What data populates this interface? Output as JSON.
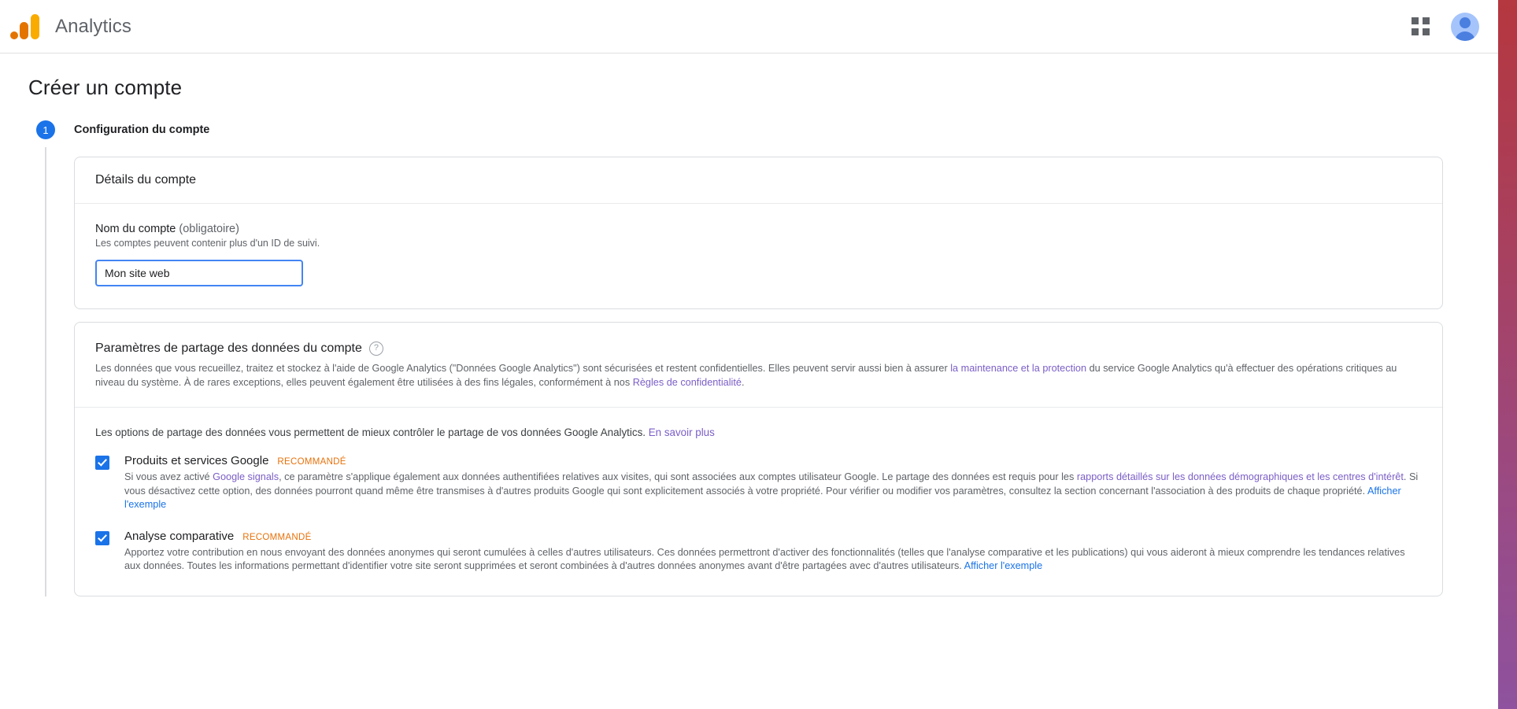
{
  "topbar": {
    "brand_title": "Analytics",
    "logo_icon": "analytics-logo-icon",
    "apps_icon": "apps-grid-icon",
    "avatar_icon": "user-avatar-icon"
  },
  "page": {
    "title": "Créer un compte"
  },
  "step": {
    "number": "1",
    "title": "Configuration du compte"
  },
  "account_details": {
    "card_title": "Détails du compte",
    "field_label": "Nom du compte",
    "field_optional": "(obligatoire)",
    "field_hint": "Les comptes peuvent contenir plus d'un ID de suivi.",
    "field_value": "Mon site web",
    "field_placeholder": ""
  },
  "data_sharing": {
    "heading": "Paramètres de partage des données du compte",
    "help_icon": "help-circle-icon",
    "intro_1": "Les données que vous recueillez, traitez et stockez à l'aide de Google Analytics (\"Données Google Analytics\") sont sécurisées et restent confidentielles. Elles peuvent servir aussi bien à assurer ",
    "intro_link_1": "la maintenance et la protection",
    "intro_2": " du service Google Analytics qu'à effectuer des opérations critiques au niveau du système. À de rares exceptions, elles peuvent également être utilisées à des fins légales, conformément à nos ",
    "intro_link_2": "Règles de confidentialité",
    "intro_3": ".",
    "lead_text": "Les options de partage des données vous permettent de mieux contrôler le partage de vos données Google Analytics. ",
    "lead_link": "En savoir plus",
    "recommended_badge": "RECOMMANDÉ",
    "options": [
      {
        "title": "Produits et services Google",
        "checked": true,
        "desc_1": "Si vous avez activé ",
        "link_1": "Google signals",
        "desc_2": ", ce paramètre s'applique également aux données authentifiées relatives aux visites, qui sont associées aux comptes utilisateur Google. Le partage des données est requis pour les ",
        "link_2": "rapports détaillés sur les données démographiques et les centres d'intérêt",
        "desc_3": ". Si vous désactivez cette option, des données pourront quand même être transmises à d'autres produits Google qui sont explicitement associés à votre propriété. Pour vérifier ou modifier vos paramètres, consultez la section concernant l'association à des produits de chaque propriété. ",
        "link_3": "Afficher l'exemple"
      },
      {
        "title": "Analyse comparative",
        "checked": true,
        "desc_1": "Apportez votre contribution en nous envoyant des données anonymes qui seront cumulées à celles d'autres utilisateurs. Ces données permettront d'activer des fonctionnalités (telles que l'analyse comparative et les publications) qui vous aideront à mieux comprendre les tendances relatives aux données. Toutes les informations permettant d'identifier votre site seront supprimées et seront combinées à d'autres données anonymes avant d'être partagées avec d'autres utilisateurs. ",
        "link_1": "Afficher l'exemple",
        "desc_2": "",
        "link_2": "",
        "desc_3": "",
        "link_3": ""
      }
    ]
  },
  "colors": {
    "accent_blue": "#1a73e8",
    "link_purple": "#7b5ec7",
    "link_blue": "#1a73e8",
    "recommended_orange": "#e8710a",
    "logo_yellow": "#f9ab00",
    "logo_orange": "#e37400"
  }
}
